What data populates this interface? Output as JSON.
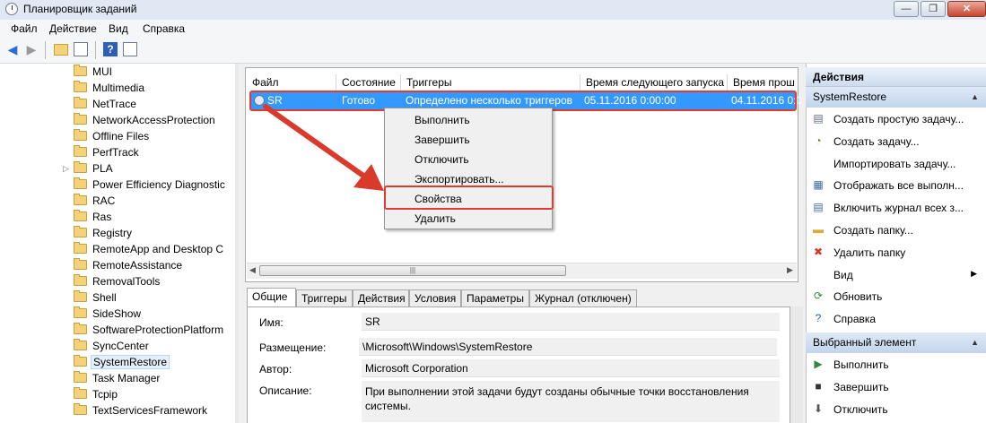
{
  "window": {
    "title": "Планировщик заданий",
    "min": "—",
    "max": "❐",
    "close": "✕"
  },
  "menu": [
    "Файл",
    "Действие",
    "Вид",
    "Справка"
  ],
  "tree": {
    "items": [
      "MUI",
      "Multimedia",
      "NetTrace",
      "NetworkAccessProtection",
      "Offline Files",
      "PerfTrack",
      "PLA",
      "Power Efficiency Diagnostic",
      "RAC",
      "Ras",
      "Registry",
      "RemoteApp and Desktop C",
      "RemoteAssistance",
      "RemovalTools",
      "Shell",
      "SideShow",
      "SoftwareProtectionPlatform",
      "SyncCenter",
      "SystemRestore",
      "Task Manager",
      "Tcpip",
      "TextServicesFramework"
    ],
    "selected": "SystemRestore",
    "expandable": "PLA"
  },
  "tasklist": {
    "columns": [
      "Файл",
      "Состояние",
      "Триггеры",
      "Время следующего запуска",
      "Время прош"
    ],
    "row": {
      "name": "SR",
      "state": "Готово",
      "triggers": "Определено несколько триггеров",
      "next_run": "05.11.2016 0:00:00",
      "last_run": "04.11.2016 0:0"
    }
  },
  "context_menu": [
    "Выполнить",
    "Завершить",
    "Отключить",
    "Экспортировать...",
    "Свойства",
    "Удалить"
  ],
  "tabs": [
    "Общие",
    "Триггеры",
    "Действия",
    "Условия",
    "Параметры",
    "Журнал (отключен)"
  ],
  "detail": {
    "name_label": "Имя:",
    "name_value": "SR",
    "location_label": "Размещение:",
    "location_value": "\\Microsoft\\Windows\\SystemRestore",
    "author_label": "Автор:",
    "author_value": "Microsoft Corporation",
    "desc_label": "Описание:",
    "desc_value_1": "При выполнении этой задачи будут созданы обычные точки восстановления",
    "desc_value_2": "системы."
  },
  "actions": {
    "header": "Действия",
    "section1": "SystemRestore",
    "items1": [
      "Создать простую задачу...",
      "Создать задачу...",
      "Импортировать задачу...",
      "Отображать все выполн...",
      "Включить журнал всех з...",
      "Создать папку...",
      "Удалить папку",
      "Вид",
      "Обновить",
      "Справка"
    ],
    "section2": "Выбранный элемент",
    "items2": [
      "Выполнить",
      "Завершить",
      "Отключить"
    ]
  },
  "colors": {
    "selection": "#3399ff",
    "highlight": "#e23b32"
  }
}
